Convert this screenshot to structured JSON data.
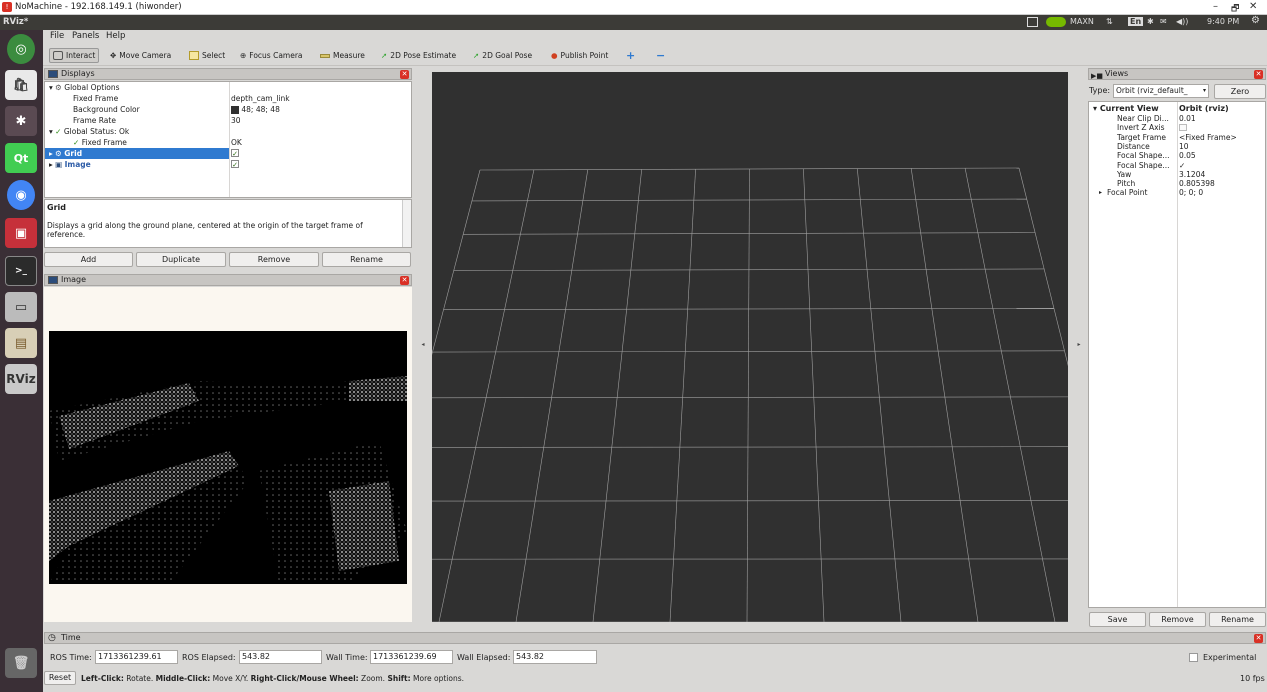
{
  "window": {
    "title": "NoMachine - 192.168.149.1 (hiwonder)",
    "minimize": "–",
    "maximize": "🗗",
    "close": "✕"
  },
  "topbar": {
    "app": "RViz*",
    "gpu_mode": "MAXN",
    "lang": "En",
    "time": "9:40 PM"
  },
  "menu": {
    "file": "File",
    "panels": "Panels",
    "help": "Help"
  },
  "toolbar": {
    "interact": "Interact",
    "move_camera": "Move Camera",
    "select": "Select",
    "focus_camera": "Focus Camera",
    "measure": "Measure",
    "pose_estimate": "2D Pose Estimate",
    "goal_pose": "2D Goal Pose",
    "publish_point": "Publish Point"
  },
  "displays": {
    "title": "Displays",
    "global_options": "Global Options",
    "fixed_frame_label": "Fixed Frame",
    "fixed_frame_value": "depth_cam_link",
    "bg_color_label": "Background Color",
    "bg_color_value": "48; 48; 48",
    "frame_rate_label": "Frame Rate",
    "frame_rate_value": "30",
    "global_status": "Global Status: Ok",
    "status_fixed_frame": "Fixed Frame",
    "status_value": "OK",
    "grid": "Grid",
    "image": "Image"
  },
  "description": {
    "title": "Grid",
    "text": "Displays a grid along the ground plane, centered at the origin of the target frame of reference."
  },
  "display_buttons": {
    "add": "Add",
    "duplicate": "Duplicate",
    "remove": "Remove",
    "rename": "Rename"
  },
  "image_panel": {
    "title": "Image"
  },
  "views": {
    "title": "Views",
    "type_label": "Type:",
    "type_value": "Orbit (rviz_default_",
    "zero": "Zero",
    "current_view": "Current View",
    "current_view_value": "Orbit (rviz)",
    "props": [
      {
        "k": "Near Clip Di...",
        "v": "0.01"
      },
      {
        "k": "Invert Z Axis",
        "v": ""
      },
      {
        "k": "Target Frame",
        "v": "<Fixed Frame>"
      },
      {
        "k": "Distance",
        "v": "10"
      },
      {
        "k": "Focal Shape...",
        "v": "0.05"
      },
      {
        "k": "Focal Shape...",
        "v": "✓"
      },
      {
        "k": "Yaw",
        "v": "3.1204"
      },
      {
        "k": "Pitch",
        "v": "0.805398"
      },
      {
        "k": "Focal Point",
        "v": "0; 0; 0"
      }
    ],
    "save": "Save",
    "remove": "Remove",
    "rename": "Rename"
  },
  "time": {
    "title": "Time",
    "ros_time_label": "ROS Time:",
    "ros_time": "1713361239.61",
    "ros_elapsed_label": "ROS Elapsed:",
    "ros_elapsed": "543.82",
    "wall_time_label": "Wall Time:",
    "wall_time": "1713361239.69",
    "wall_elapsed_label": "Wall Elapsed:",
    "wall_elapsed": "543.82",
    "experimental": "Experimental"
  },
  "status": {
    "reset": "Reset",
    "left": "Left-Click:",
    "left_t": " Rotate. ",
    "middle": "Middle-Click:",
    "middle_t": " Move X/Y. ",
    "right": "Right-Click/Mouse Wheel:",
    "right_t": " Zoom. ",
    "shift": "Shift:",
    "shift_t": " More options.",
    "fps": "10 fps"
  },
  "colors": {
    "background": "#303030",
    "grid": "#a0a0a0",
    "selection": "#2f7ad0"
  }
}
